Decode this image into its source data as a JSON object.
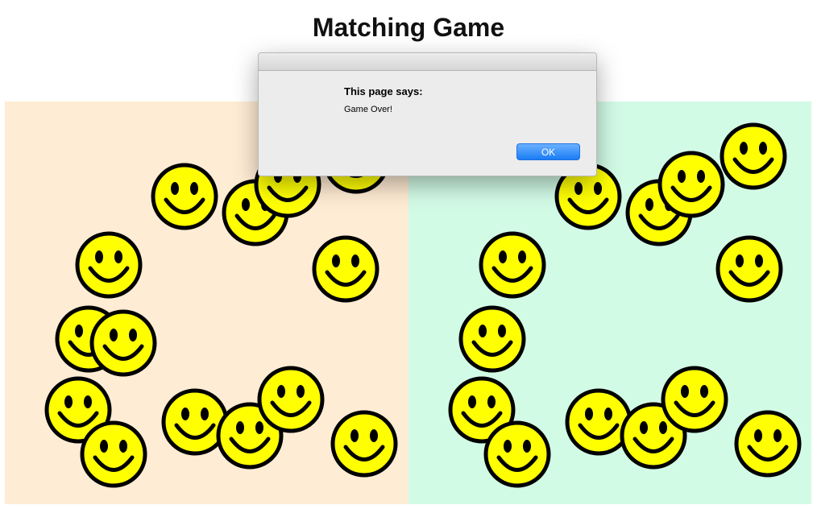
{
  "page": {
    "title": "Matching Game"
  },
  "colors": {
    "left_board": "#ffecd4",
    "right_board": "#d2fbe6",
    "smiley_face": "#ffff00",
    "smiley_outline": "#000000"
  },
  "game": {
    "icon": "smiley-face-icon",
    "left_smiley_count": 16,
    "right_smiley_count": 15
  },
  "dialog": {
    "heading": "This page says:",
    "message": "Game Over!",
    "ok_label": "OK"
  }
}
